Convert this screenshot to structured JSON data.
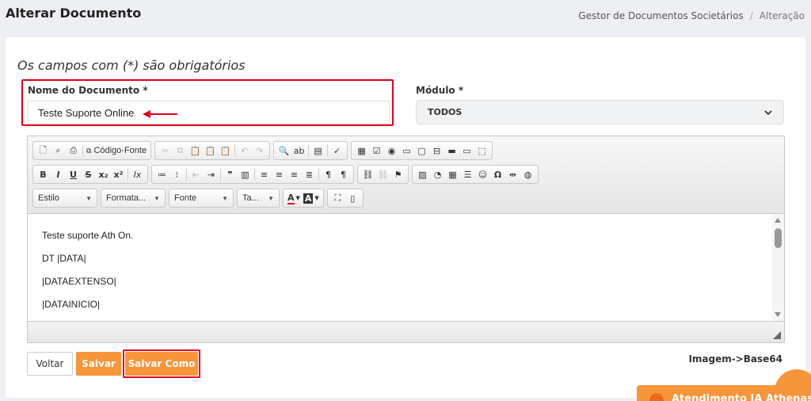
{
  "header": {
    "title": "Alterar Documento",
    "breadcrumb": [
      "Gestor de Documentos Societários",
      "Alteração"
    ],
    "breadcrumb_separator": "/"
  },
  "form": {
    "required_note": "Os campos com (*) são obrigatórios",
    "name_field": {
      "label": "Nome do Documento *",
      "value": "Teste Suporte Online"
    },
    "module_field": {
      "label": "Módulo *",
      "selected": "TODOS"
    }
  },
  "editor": {
    "toolbar": {
      "source_label": "Código-Fonte",
      "style_combo": "Estilo",
      "format_combo": "Formata...",
      "font_combo": "Fonte",
      "size_combo": "Ta...",
      "font_color": "A",
      "bg_color": "A"
    },
    "content_lines": [
      "Teste suporte Ath On.",
      "DT |DATA|",
      "|DATAEXTENSO|",
      "|DATAINICIO|"
    ]
  },
  "actions": {
    "back": "Voltar",
    "save": "Salvar",
    "save_as": "Salvar Como",
    "image_base64": "Imagem->Base64"
  },
  "chat": {
    "label": "Atendimento IA Athenas"
  },
  "colors": {
    "accent": "#f7953b",
    "highlight": "#e3001b"
  }
}
